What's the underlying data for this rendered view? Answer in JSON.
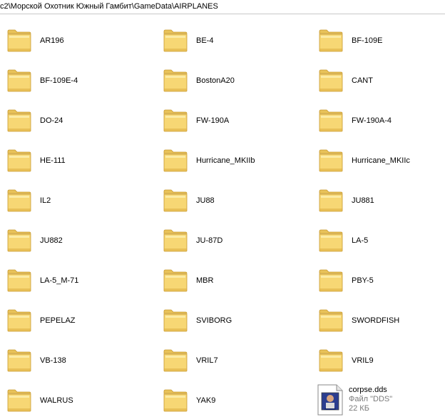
{
  "address": {
    "path": "c2\\Морской Охотник Южный Гамбит\\GameData\\AIRPLANES"
  },
  "folders": [
    "AR196",
    "BE-4",
    "BF-109E",
    "BF-109E-4",
    "BostonA20",
    "CANT",
    "DO-24",
    "FW-190A",
    "FW-190A-4",
    "HE-111",
    "Hurricane_MKIIb",
    "Hurricane_MKIIc",
    "IL2",
    "JU88",
    "JU881",
    "JU882",
    "JU-87D",
    "LA-5",
    "LA-5_M-71",
    "MBR",
    "PBY-5",
    "PEPELAZ",
    "SVIBORG",
    "SWORDFISH",
    "VB-138",
    "VRIL7",
    "VRIL9",
    "WALRUS",
    "YAK9"
  ],
  "file": {
    "name": "corpse.dds",
    "type": "Файл \"DDS\"",
    "size": "22 КБ"
  },
  "icons": {
    "folder": "folder-icon",
    "file": "dds-file-icon"
  },
  "colors": {
    "folder_fill": "#f7d774",
    "folder_light": "#fdf0b0",
    "folder_dark": "#d9a93a"
  }
}
